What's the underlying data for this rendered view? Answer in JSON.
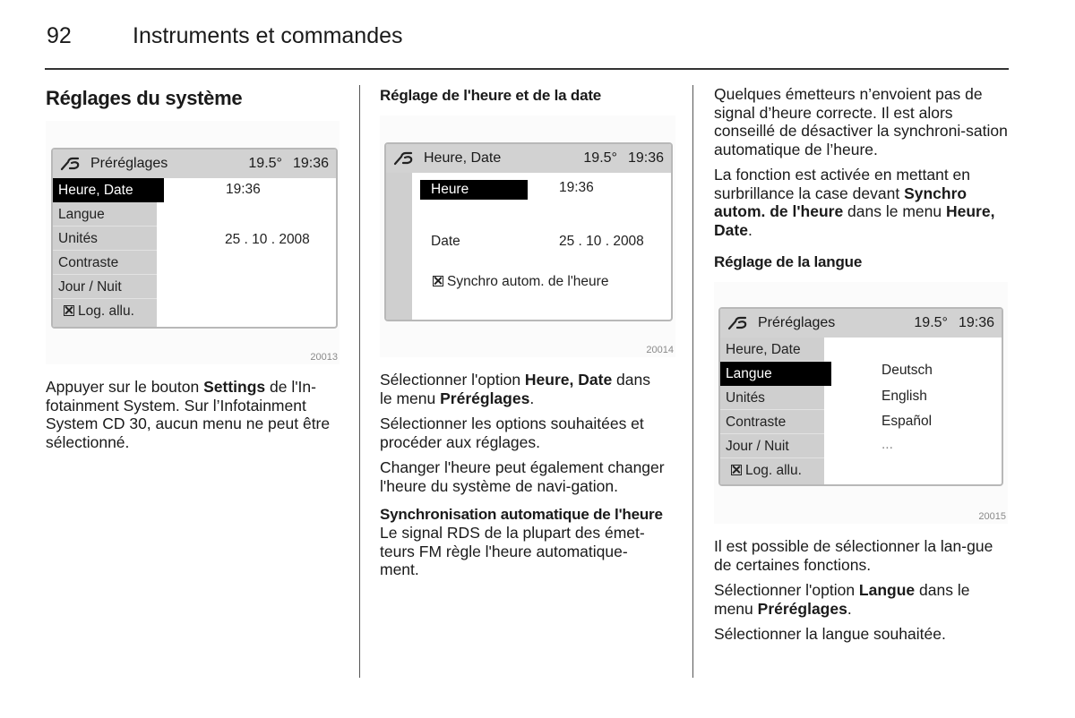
{
  "header": {
    "page_number": "92",
    "title": "Instruments et commandes"
  },
  "col1": {
    "heading": "Réglages du système",
    "figure": {
      "number": "20013",
      "screen": {
        "icon": "settings-wrench-icon",
        "title": "Préréglages",
        "temperature": "19.5°",
        "time": "19:36",
        "menu": [
          "Heure, Date",
          "Langue",
          "Unités",
          "Contraste",
          "Jour / Nuit",
          "Log. allu."
        ],
        "selected_index": 0,
        "values": {
          "time": "19:36",
          "date": "25 . 10 . 2008"
        }
      }
    },
    "para1": {
      "a": "Appuyer sur le bouton ",
      "b": "Settings",
      "c": " de l'In-fotainment System. Sur l’Infotainment System CD 30, aucun menu ne peut être sélectionné."
    }
  },
  "col2": {
    "heading": "Réglage de l'heure et de la date",
    "figure": {
      "number": "20014",
      "screen": {
        "icon": "settings-wrench-icon",
        "title": "Heure, Date",
        "temperature": "19.5°",
        "time": "19:36",
        "heure_label": "Heure",
        "heure_value": "19:36",
        "date_label": "Date",
        "date_value": "25 . 10 . 2008",
        "sync_label": "Synchro autom. de l'heure",
        "sync_checked": true
      }
    },
    "para1": {
      "a": "Sélectionner l'option ",
      "b": "Heure, Date",
      "c": " dans le menu ",
      "d": "Préréglages",
      "e": "."
    },
    "para2": "Sélectionner les options souhaitées et procéder aux réglages.",
    "para3": "Changer l'heure peut également changer l'heure du système de navi-gation.",
    "sub_heading": "Synchronisation automatique de l'heure",
    "para4": "Le signal RDS de la plupart des émet-teurs FM règle l'heure automatique-ment."
  },
  "col3": {
    "para1": "Quelques émetteurs n’envoient pas de signal d’heure correcte. Il est alors conseillé de désactiver la synchroni-sation automatique de l’heure.",
    "para2": {
      "a": "La fonction est activée en mettant en surbrillance la case devant ",
      "b": "Synchro autom. de l'heure",
      "c": " dans le menu ",
      "d": "Heure, Date",
      "e": "."
    },
    "heading": "Réglage de la langue",
    "figure": {
      "number": "20015",
      "screen": {
        "icon": "settings-wrench-icon",
        "title": "Préréglages",
        "temperature": "19.5°",
        "time": "19:36",
        "menu": [
          "Heure, Date",
          "Langue",
          "Unités",
          "Contraste",
          "Jour / Nuit",
          "Log. allu."
        ],
        "selected_index": 1,
        "languages": [
          "Deutsch",
          "English",
          "Español",
          "..."
        ]
      }
    },
    "para3": "Il est possible de sélectionner la lan-gue de certaines fonctions.",
    "para4": {
      "a": "Sélectionner l'option ",
      "b": "Langue",
      "c": " dans le menu ",
      "d": "Préréglages",
      "e": "."
    },
    "para5": "Sélectionner la langue souhaitée."
  }
}
